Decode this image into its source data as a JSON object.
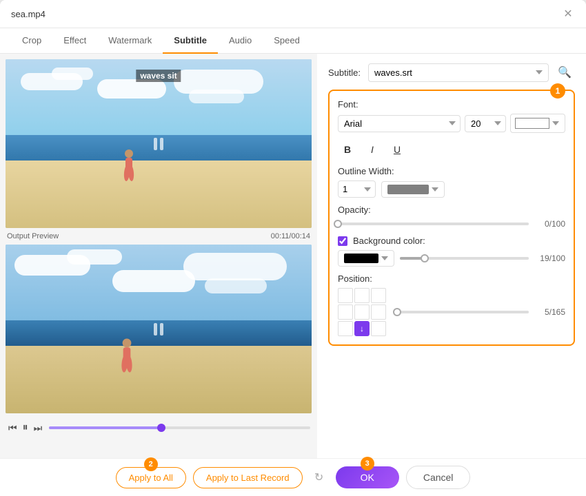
{
  "window": {
    "title": "sea.mp4",
    "close_icon": "✕"
  },
  "tabs": [
    {
      "label": "Crop",
      "active": false
    },
    {
      "label": "Effect",
      "active": false
    },
    {
      "label": "Watermark",
      "active": false
    },
    {
      "label": "Subtitle",
      "active": true
    },
    {
      "label": "Audio",
      "active": false
    },
    {
      "label": "Speed",
      "active": false
    }
  ],
  "preview": {
    "label": "Output Preview",
    "time": "00:11/00:14"
  },
  "subtitle": {
    "label": "Subtitle:",
    "file": "waves.srt",
    "text_overlay": "waves sit"
  },
  "font_section": {
    "label": "Font:",
    "font_name": "Arial",
    "font_size": "20",
    "bold": "B",
    "italic": "I",
    "underline": "U"
  },
  "outline": {
    "label": "Outline Width:",
    "width_value": "1"
  },
  "opacity": {
    "label": "Opacity:",
    "value": "0/100"
  },
  "background": {
    "label": "Background color:",
    "value": "19/100"
  },
  "position": {
    "label": "Position:",
    "value": "5/165"
  },
  "buttons": {
    "apply_all": "Apply to All",
    "apply_last": "Apply to Last Record",
    "ok": "OK",
    "cancel": "Cancel"
  },
  "steps": {
    "step1": "1",
    "step2": "2",
    "step3": "3"
  }
}
